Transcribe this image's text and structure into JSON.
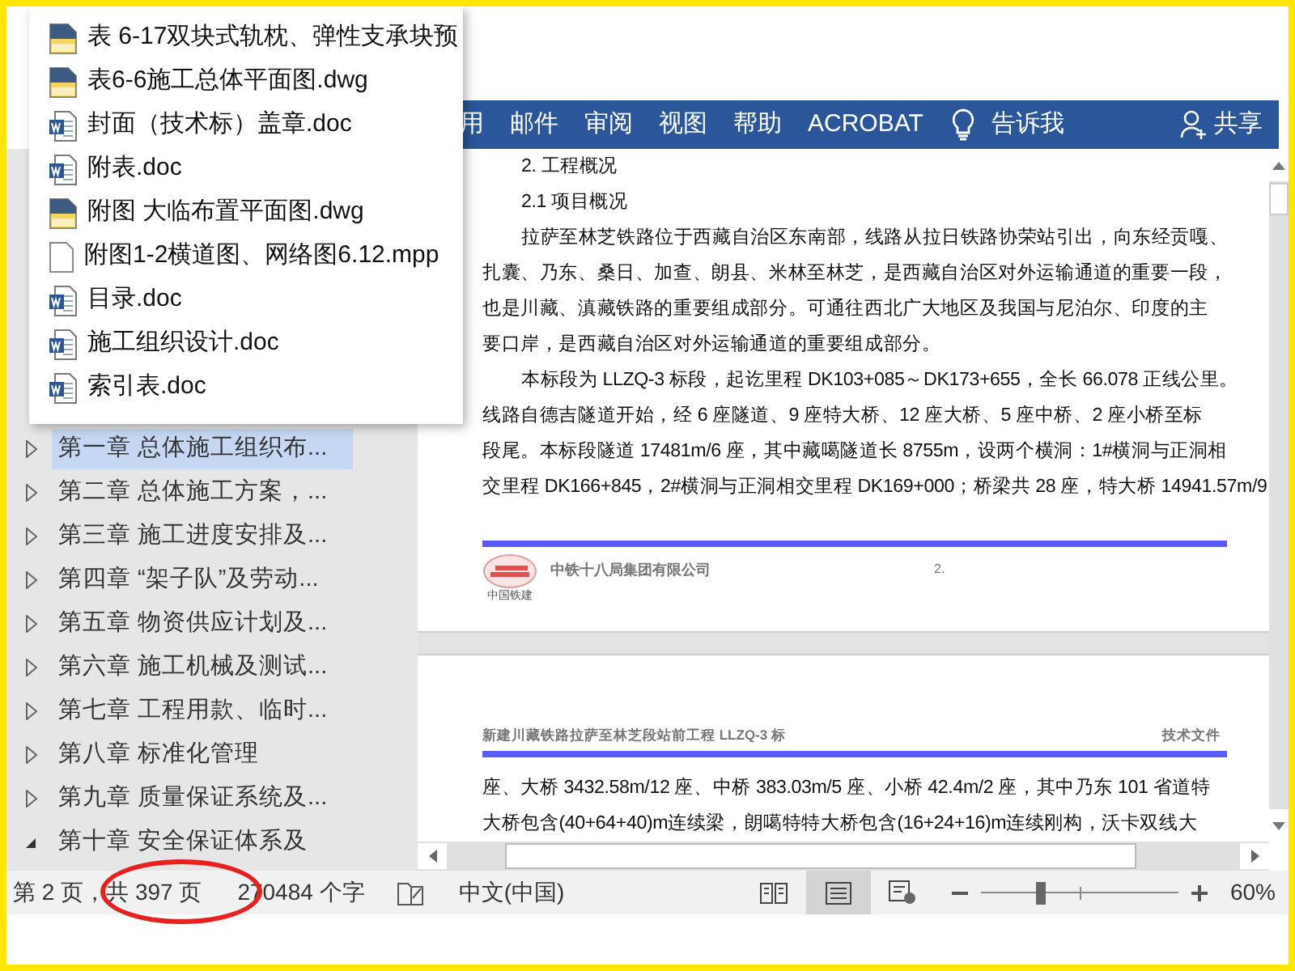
{
  "recent_files": [
    {
      "name": "表 6-17双块式轨枕、弹性支承块预",
      "kind": "dwg"
    },
    {
      "name": "表6-6施工总体平面图.dwg",
      "kind": "dwg"
    },
    {
      "name": "封面（技术标）盖章.doc",
      "kind": "doc"
    },
    {
      "name": "附表.doc",
      "kind": "doc"
    },
    {
      "name": "附图   大临布置平面图.dwg",
      "kind": "dwg"
    },
    {
      "name": "附图1-2横道图、网络图6.12.mpp",
      "kind": "mpp"
    },
    {
      "name": "目录.doc",
      "kind": "doc"
    },
    {
      "name": "施工组织设计.doc",
      "kind": "doc"
    },
    {
      "name": "索引表.doc",
      "kind": "doc"
    }
  ],
  "ribbon": {
    "tabs": [
      "用",
      "邮件",
      "审阅",
      "视图",
      "帮助",
      "ACROBAT"
    ],
    "tell_me": "告诉我",
    "share": "共享"
  },
  "navigation": {
    "items": [
      {
        "label": "第一章  总体施工组织布...",
        "selected": true,
        "expanded": false
      },
      {
        "label": "第二章  总体施工方案，...",
        "selected": false,
        "expanded": false
      },
      {
        "label": "第三章  施工进度安排及...",
        "selected": false,
        "expanded": false
      },
      {
        "label": "第四章  “架子队”及劳动...",
        "selected": false,
        "expanded": false
      },
      {
        "label": "第五章  物资供应计划及...",
        "selected": false,
        "expanded": false
      },
      {
        "label": "第六章  施工机械及测试...",
        "selected": false,
        "expanded": false
      },
      {
        "label": "第七章  工程用款、临时...",
        "selected": false,
        "expanded": false
      },
      {
        "label": "第八章  标准化管理",
        "selected": false,
        "expanded": false
      },
      {
        "label": "第九章  质量保证系统及...",
        "selected": false,
        "expanded": false
      },
      {
        "label": "第十章  安全保证体系及",
        "selected": false,
        "expanded": true
      }
    ]
  },
  "document": {
    "page1_lines": [
      {
        "text": "2. 工程概况",
        "indent": true
      },
      {
        "text": "2.1  项目概况",
        "indent": true
      },
      {
        "text": "拉萨至林芝铁路位于西藏自治区东南部，线路从拉日铁路协荣站引出，向东经贡嘎、",
        "indent": true
      },
      {
        "text": "扎囊、乃东、桑日、加查、朗县、米林至林芝，是西藏自治区对外运输通道的重要一段，",
        "indent": false
      },
      {
        "text": "也是川藏、滇藏铁路的重要组成部分。可通往西北广大地区及我国与尼泊尔、印度的主",
        "indent": false
      },
      {
        "text": "要口岸，是西藏自治区对外运输通道的重要组成部分。",
        "indent": false
      },
      {
        "text": "本标段为 LLZQ-3 标段，起讫里程 DK103+085～DK173+655，全长 66.078 正线公里。",
        "indent": true
      },
      {
        "text": "线路自德吉隧道开始，经 6 座隧道、9 座特大桥、12 座大桥、5 座中桥、2 座小桥至标",
        "indent": false
      },
      {
        "text": "段尾。本标段隧道 17481m/6 座，其中藏噶隧道长 8755m，设两个横洞：1#横洞与正洞相",
        "indent": false
      },
      {
        "text": "交里程 DK166+845，2#横洞与正洞相交里程 DK169+000；桥梁共 28 座，特大桥 14941.57m/9",
        "indent": false
      }
    ],
    "footer_company": "中铁十八局集团有限公司",
    "footer_logo_caption": "中国铁建",
    "footer_page": "2.",
    "header_title": "新建川藏铁路拉萨至林芝段站前工程 LLZQ-3 标",
    "header_right": "技术文件",
    "page2_lines": [
      {
        "text": "座、大桥 3432.58m/12 座、中桥 383.03m/5 座、小桥 42.4m/2 座，其中乃东 101 省道特",
        "indent": false
      },
      {
        "text": "大桥包含(40+64+40)m连续梁，朗噶特特大桥包含(16+24+16)m连续刚构，沃卡双线大",
        "indent": false
      }
    ]
  },
  "status_bar": {
    "page": "第 2 页，共 397 页",
    "words": "270484 个字",
    "language": "中文(中国)",
    "views": [
      {
        "kind": "read",
        "selected": false
      },
      {
        "kind": "print",
        "selected": true
      },
      {
        "kind": "web",
        "selected": false
      }
    ],
    "zoom_slider": {
      "level": 0.3
    },
    "zoom": "60%"
  }
}
